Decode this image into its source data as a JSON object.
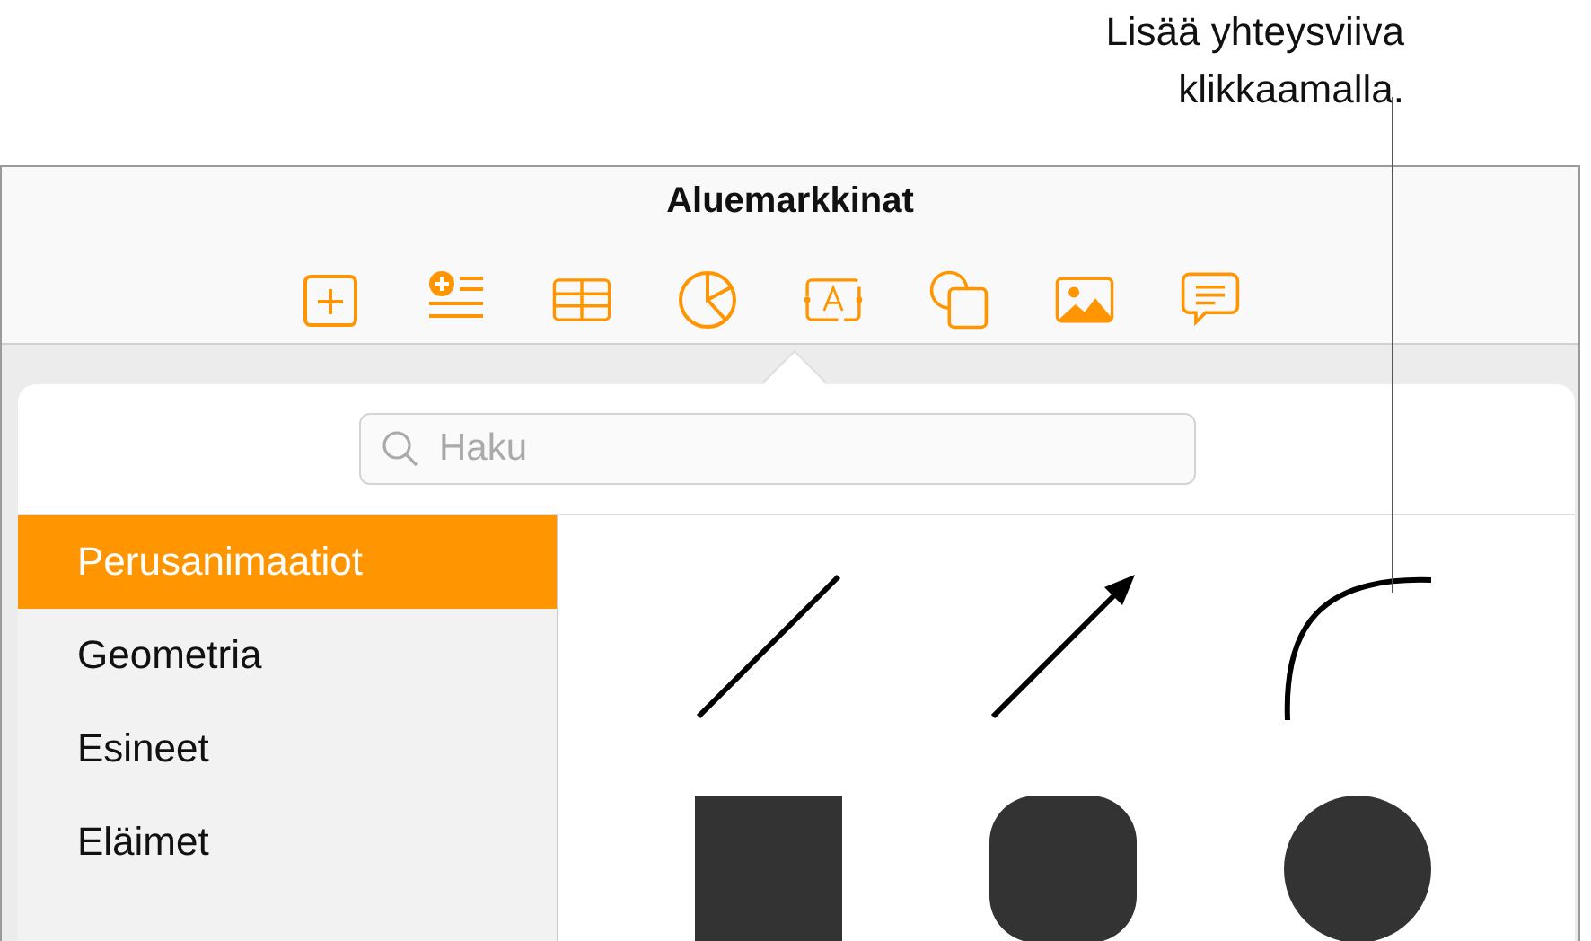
{
  "callout": [
    "Lisää yhteysviiva",
    "klikkaamalla."
  ],
  "window": {
    "title": "Aluemarkkinat"
  },
  "toolbar": {
    "items": [
      {
        "kind": "add"
      },
      {
        "kind": "text-list"
      },
      {
        "kind": "table"
      },
      {
        "kind": "chart"
      },
      {
        "kind": "text-box"
      },
      {
        "kind": "shape"
      },
      {
        "kind": "media"
      },
      {
        "kind": "comment"
      }
    ]
  },
  "search": {
    "placeholder": "Haku"
  },
  "categories": [
    {
      "label": "Perusanimaatiot",
      "selected": true
    },
    {
      "label": "Geometria",
      "selected": false
    },
    {
      "label": "Esineet",
      "selected": false
    },
    {
      "label": "Eläimet",
      "selected": false
    }
  ],
  "shapes": [
    {
      "kind": "line"
    },
    {
      "kind": "arrow"
    },
    {
      "kind": "curve"
    },
    {
      "kind": "square"
    },
    {
      "kind": "rounded-square"
    },
    {
      "kind": "circle"
    }
  ]
}
